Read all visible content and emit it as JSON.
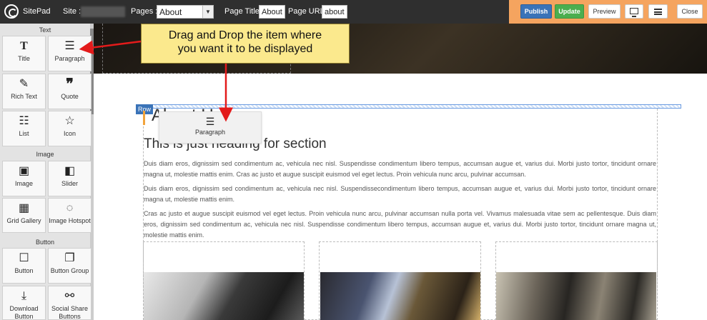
{
  "topbar": {
    "brand": "SitePad",
    "site_label": "Site :",
    "pages_label": "Pages :",
    "pages_selected": "About",
    "page_title_label": "Page Title:",
    "page_title_value": "About",
    "page_url_label": "Page URL:",
    "page_url_value": "about",
    "buttons": {
      "publish": "Publish",
      "update": "Update",
      "preview": "Preview",
      "close": "Close"
    },
    "colors": {
      "actions_bg": "#f5a45f",
      "publish": "#3a73b8",
      "update": "#4bae4f"
    }
  },
  "sidebar": {
    "categories": {
      "text": "Text",
      "image": "Image",
      "button": "Button"
    },
    "items": [
      {
        "label": "Title",
        "icon": "title-icon"
      },
      {
        "label": "Paragraph",
        "icon": "paragraph-icon"
      },
      {
        "label": "Rich Text",
        "icon": "rich-text-icon"
      },
      {
        "label": "Quote",
        "icon": "quote-icon"
      },
      {
        "label": "List",
        "icon": "list-icon"
      },
      {
        "label": "Icon",
        "icon": "star-icon"
      },
      {
        "label": "Image",
        "icon": "image-icon"
      },
      {
        "label": "Slider",
        "icon": "slider-icon"
      },
      {
        "label": "Grid Gallery",
        "icon": "grid-gallery-icon"
      },
      {
        "label": "Image Hotspot",
        "icon": "image-hotspot-icon"
      },
      {
        "label": "Button",
        "icon": "button-icon"
      },
      {
        "label": "Button Group",
        "icon": "button-group-icon"
      },
      {
        "label": "Download Button",
        "icon": "download-icon"
      },
      {
        "label": "Social Share Buttons",
        "icon": "share-icon"
      }
    ]
  },
  "canvas": {
    "row_tag": "Row",
    "heading": "About Us",
    "subheading": "This is just heading for section",
    "paragraphs": [
      "Duis diam eros, dignissim sed condimentum ac, vehicula nec nisl. Suspendisse condimentum libero tempus, accumsan augue et, varius dui. Morbi justo tortor, tincidunt ornare magna ut, molestie mattis enim. Cras ac justo et augue suscipit euismod vel eget lectus. Proin vehicula nunc arcu, pulvinar accumsan.",
      "Duis diam eros, dignissim sed condimentum ac, vehicula nec nisl. Suspendissecondimentum libero tempus, accumsan augue et, varius dui. Morbi justo tortor, tincidunt ornare magna ut, molestie mattis enim.",
      "Cras ac justo et augue suscipit euismod vel eget lectus. Proin vehicula nunc arcu, pulvinar accumsan nulla porta vel. Vivamus malesuada vitae sem ac pellentesque. Duis diam eros, dignissim sed condimentum ac, vehicula nec nisl. Suspendisse condimentum libero tempus, accumsan augue et, varius dui. Morbi justo tortor, tincidunt ornare magna ut, molestie mattis enim."
    ],
    "dragging_item": "Paragraph"
  },
  "callout": {
    "line1": "Drag and Drop the item where",
    "line2": "you want it to be displayed",
    "color": "#fbe98d"
  }
}
